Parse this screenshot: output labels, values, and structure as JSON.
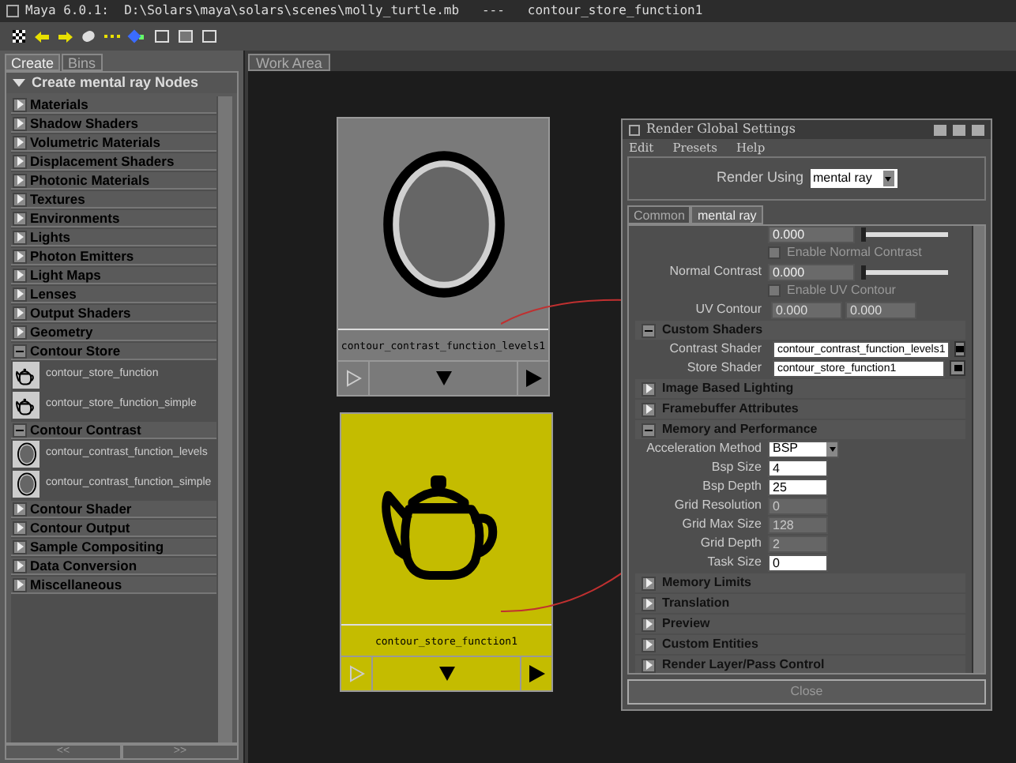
{
  "window": {
    "title": "Maya 6.0.1:  D:\\Solars\\maya\\solars\\scenes\\molly_turtle.mb   ---   contour_store_function1"
  },
  "left_panel": {
    "tabs": [
      {
        "label": "Create",
        "selected": true
      },
      {
        "label": "Bins",
        "selected": false
      }
    ],
    "header": {
      "title": "Create mental ray Nodes",
      "expanded": true
    },
    "sections": [
      {
        "title": "Materials",
        "expanded": false
      },
      {
        "title": "Shadow Shaders",
        "expanded": false
      },
      {
        "title": "Volumetric Materials",
        "expanded": false
      },
      {
        "title": "Displacement Shaders",
        "expanded": false
      },
      {
        "title": "Photonic Materials",
        "expanded": false
      },
      {
        "title": "Textures",
        "expanded": false
      },
      {
        "title": "Environments",
        "expanded": false
      },
      {
        "title": "Lights",
        "expanded": false
      },
      {
        "title": "Photon Emitters",
        "expanded": false
      },
      {
        "title": "Light Maps",
        "expanded": false
      },
      {
        "title": "Lenses",
        "expanded": false
      },
      {
        "title": "Output Shaders",
        "expanded": false
      },
      {
        "title": "Geometry",
        "expanded": false
      },
      {
        "title": "Contour Store",
        "expanded": true,
        "items": [
          {
            "label": "contour_store_function",
            "kind": "teapot"
          },
          {
            "label": "contour_store_function_simple",
            "kind": "teapot"
          }
        ]
      },
      {
        "title": "Contour Contrast",
        "expanded": true,
        "items": [
          {
            "label": "contour_contrast_function_levels",
            "kind": "sphere"
          },
          {
            "label": "contour_contrast_function_simple",
            "kind": "sphere"
          }
        ]
      },
      {
        "title": "Contour Shader",
        "expanded": false
      },
      {
        "title": "Contour Output",
        "expanded": false
      },
      {
        "title": "Sample Compositing",
        "expanded": false
      },
      {
        "title": "Data Conversion",
        "expanded": false
      },
      {
        "title": "Miscellaneous",
        "expanded": false
      }
    ],
    "pager": [
      "<<",
      ">>"
    ]
  },
  "work_area": {
    "tab": "Work Area",
    "nodes": [
      {
        "label": "contour_contrast_function_levels1",
        "kind": "sphere",
        "color": "#7a7a7a"
      },
      {
        "label": "contour_store_function1",
        "kind": "teapot",
        "color": "#c4bc00"
      }
    ]
  },
  "dialog": {
    "title": "Render Global Settings",
    "menu": [
      "Edit",
      "Presets",
      "Help"
    ],
    "render_using": {
      "label": "Render Using",
      "value": "mental ray"
    },
    "tabs": [
      {
        "label": "Common",
        "selected": false
      },
      {
        "label": "mental ray",
        "selected": true
      }
    ],
    "rows": [
      {
        "kind": "slider",
        "value": "0.000",
        "level": 0
      },
      {
        "kind": "checkbox",
        "label": "Enable Normal Contrast",
        "checked": false
      },
      {
        "kind": "slider",
        "label": "Normal Contrast",
        "value": "0.000",
        "level": 0
      },
      {
        "kind": "checkbox",
        "label": "Enable UV Contour",
        "checked": false
      },
      {
        "kind": "pair",
        "label": "UV Contour",
        "values": [
          "0.000",
          "0.000"
        ]
      },
      {
        "kind": "section",
        "title": "Custom Shaders",
        "expanded": true
      },
      {
        "kind": "link",
        "label": "Contrast Shader",
        "value": "contour_contrast_function_levels1"
      },
      {
        "kind": "link",
        "label": "Store Shader",
        "value": "contour_store_function1"
      },
      {
        "kind": "section",
        "title": "Image Based Lighting",
        "expanded": false
      },
      {
        "kind": "section",
        "title": "Framebuffer Attributes",
        "expanded": false
      },
      {
        "kind": "section",
        "title": "Memory and Performance",
        "expanded": true
      },
      {
        "kind": "dropdown",
        "label": "Acceleration Method",
        "value": "BSP"
      },
      {
        "kind": "field",
        "label": "Bsp Size",
        "value": "4",
        "disabled": false
      },
      {
        "kind": "field",
        "label": "Bsp Depth",
        "value": "25",
        "disabled": false
      },
      {
        "kind": "field",
        "label": "Grid Resolution",
        "value": "0",
        "disabled": true
      },
      {
        "kind": "field",
        "label": "Grid Max Size",
        "value": "128",
        "disabled": true
      },
      {
        "kind": "field",
        "label": "Grid Depth",
        "value": "2",
        "disabled": true
      },
      {
        "kind": "field",
        "label": "Task Size",
        "value": "0",
        "disabled": false
      },
      {
        "kind": "section",
        "title": "Memory Limits",
        "expanded": false
      },
      {
        "kind": "section",
        "title": "Translation",
        "expanded": false
      },
      {
        "kind": "section",
        "title": "Preview",
        "expanded": false
      },
      {
        "kind": "section",
        "title": "Custom Entities",
        "expanded": false
      },
      {
        "kind": "section",
        "title": "Render Layer/Pass Control",
        "expanded": false
      }
    ],
    "close": "Close"
  }
}
